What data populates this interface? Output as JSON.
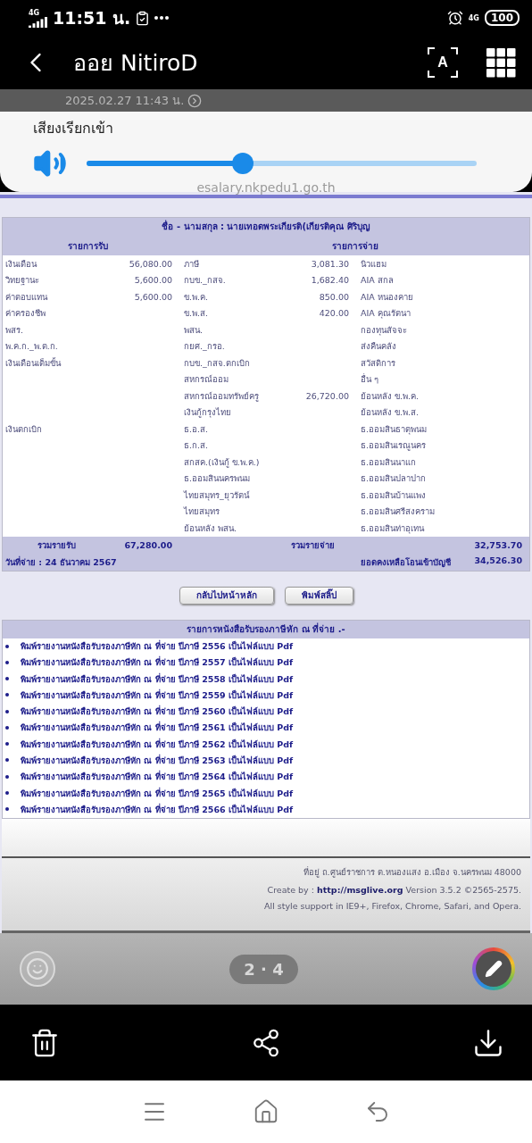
{
  "status_bar": {
    "network": "4G",
    "time": "11:51 น.",
    "data_type": "4G",
    "battery": "100"
  },
  "header": {
    "title": "ออย NitiroD",
    "subtitle": "2025.02.27 11:43 น.",
    "text_recognition_label": "A"
  },
  "volume": {
    "label": "เสียงเรียกเข้า",
    "level": 0.4
  },
  "browser_bar": {
    "url": "esalary.nkpedu1.go.th"
  },
  "salary_slip": {
    "name_line": "ชื่อ - นามสกุล : นายเทอดพระเกียรติ(เกียรติคุณ ศิริบุญ",
    "income_heading": "รายการรับ",
    "deduction_heading": "รายการจ่าย",
    "rows": [
      {
        "income": "เงินเดือน",
        "income_amount": "56,080.00",
        "deduction": "ภาษี",
        "deduction_amount": "3,081.30",
        "deduction_2": "นิวแฮม"
      },
      {
        "income": "วิทยฐานะ",
        "income_amount": "5,600.00",
        "deduction": "กบข._กสจ.",
        "deduction_amount": "1,682.40",
        "deduction_2": "AIA สกล"
      },
      {
        "income": "ค่าตอบแทน",
        "income_amount": "5,600.00",
        "deduction": "ข.พ.ค.",
        "deduction_amount": "850.00",
        "deduction_2": "AIA หนองคาย"
      },
      {
        "income": "ค่าครองชีพ",
        "deduction": "ข.พ.ส.",
        "deduction_amount": "420.00",
        "deduction_2": "AIA คุณรัตนา"
      },
      {
        "income": "พสร.",
        "deduction": "พสน.",
        "deduction_2": "กองทุนสัจจะ"
      },
      {
        "income": "พ.ค.ก._พ.ต.ก.",
        "deduction": "กยศ._กรอ.",
        "deduction_2": "ส่งคืนคลัง"
      },
      {
        "income": "เงินเดือนเต็มขั้น",
        "deduction": "กบข._กสจ.ตกเบิก",
        "deduction_2": "สวัสดิการ"
      },
      {
        "deduction": "สหกรณ์ออม",
        "deduction_2": "อื่น ๆ"
      },
      {
        "deduction": "สหกรณ์ออมทรัพย์ครู",
        "deduction_amount": "26,720.00",
        "deduction_2": "ย้อนหลัง ข.พ.ค."
      },
      {
        "deduction": "เงินกู้กรุงไทย",
        "deduction_2": "ย้อนหลัง ข.พ.ส."
      },
      {
        "income": "เงินตกเบิก",
        "deduction": "ธ.อ.ส.",
        "deduction_2": "ธ.ออมสินธาตุพนม"
      },
      {
        "deduction": "ธ.ก.ส.",
        "deduction_2": "ธ.ออมสินเรณูนคร"
      },
      {
        "deduction": "สกสค.(เงินกู้ ข.พ.ค.)",
        "deduction_2": "ธ.ออมสินนาแก"
      },
      {
        "deduction": "ธ.ออมสินนครพนม",
        "deduction_2": "ธ.ออมสินปลาปาก"
      },
      {
        "deduction": "ไทยสมุทร_ยุวรัตน์",
        "deduction_2": "ธ.ออมสินบ้านแพง"
      },
      {
        "deduction": "ไทยสมุทร",
        "deduction_2": "ธ.ออมสินศรีสงคราม"
      },
      {
        "deduction": "ย้อนหลัง พสน.",
        "deduction_2": "ธ.ออมสินท่าอุเทน"
      }
    ],
    "totals": {
      "income_label": "รวมรายรับ",
      "income_total": "67,280.00",
      "deduction_label": "รวมรายจ่าย",
      "deduction_total": "32,753.70",
      "pay_date": "วันที่จ่าย : 24 ธันวาคม 2567",
      "balance_label": "ยอดคงเหลือโอนเข้าบัญชี",
      "balance": "34,526.30"
    }
  },
  "buttons": [
    {
      "label": "กลับไปหน้าหลัก"
    },
    {
      "label": "พิมพ์สลิ๊ป"
    }
  ],
  "certificates": {
    "heading": "รายการหนังสือรับรองภาษีหัก ณ ที่จ่าย .-",
    "items": [
      "พิมพ์รายงานหนังสือรับรองภาษีหัก ณ ที่จ่าย ปีภาษี 2556 เป็นไฟล์แบบ Pdf",
      "พิมพ์รายงานหนังสือรับรองภาษีหัก ณ ที่จ่าย ปีภาษี 2557 เป็นไฟล์แบบ Pdf",
      "พิมพ์รายงานหนังสือรับรองภาษีหัก ณ ที่จ่าย ปีภาษี 2558 เป็นไฟล์แบบ Pdf",
      "พิมพ์รายงานหนังสือรับรองภาษีหัก ณ ที่จ่าย ปีภาษี 2559 เป็นไฟล์แบบ Pdf",
      "พิมพ์รายงานหนังสือรับรองภาษีหัก ณ ที่จ่าย ปีภาษี 2560 เป็นไฟล์แบบ Pdf",
      "พิมพ์รายงานหนังสือรับรองภาษีหัก ณ ที่จ่าย ปีภาษี 2561 เป็นไฟล์แบบ Pdf",
      "พิมพ์รายงานหนังสือรับรองภาษีหัก ณ ที่จ่าย ปีภาษี 2562 เป็นไฟล์แบบ Pdf",
      "พิมพ์รายงานหนังสือรับรองภาษีหัก ณ ที่จ่าย ปีภาษี 2563 เป็นไฟล์แบบ Pdf",
      "พิมพ์รายงานหนังสือรับรองภาษีหัก ณ ที่จ่าย ปีภาษี 2564 เป็นไฟล์แบบ Pdf",
      "พิมพ์รายงานหนังสือรับรองภาษีหัก ณ ที่จ่าย ปีภาษี 2565 เป็นไฟล์แบบ Pdf",
      "พิมพ์รายงานหนังสือรับรองภาษีหัก ณ ที่จ่าย ปีภาษี 2566 เป็นไฟล์แบบ Pdf"
    ]
  },
  "footer": {
    "address": "ที่อยู่ ถ.ศูนย์ราชการ ต.หนองแสง อ.เมือง จ.นครพนม 48000",
    "create_by_label": "Create by :",
    "create_by_link": "http://msglive.org",
    "version": "Version 3.5.2 ©2565-2575.",
    "support": "All style support in IE9+, Firefox, Chrome, Safari, and Opera."
  },
  "viewer": {
    "page_indicator": "2 · 4"
  }
}
